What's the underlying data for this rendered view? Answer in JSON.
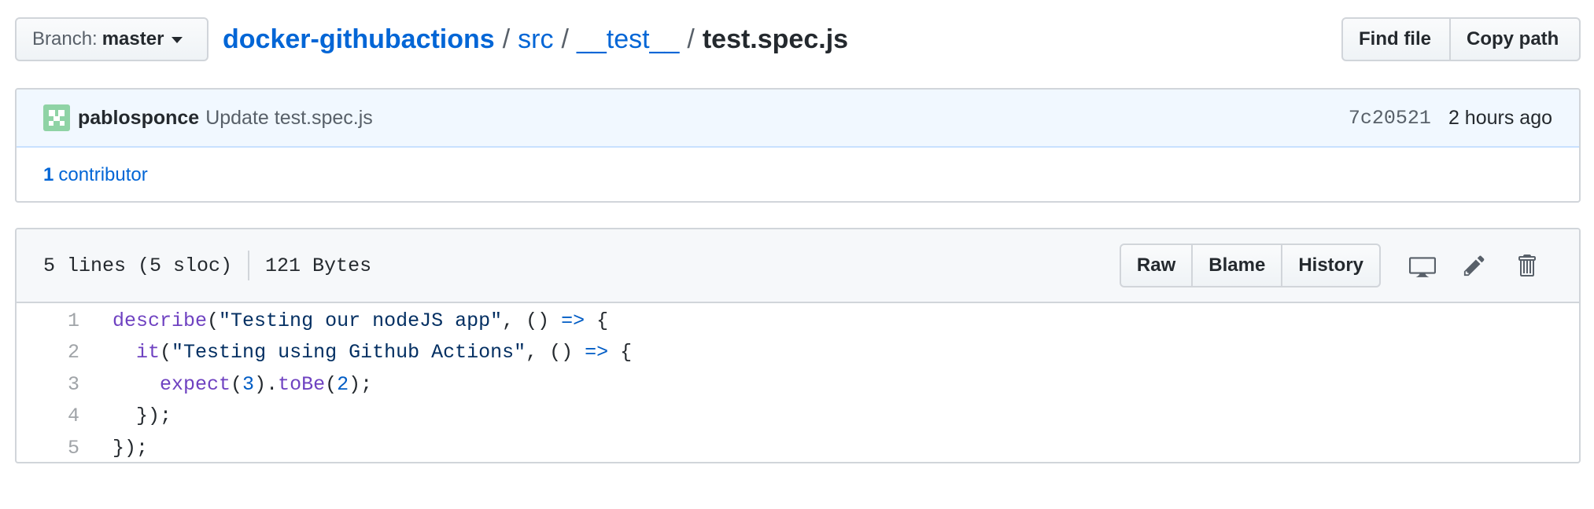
{
  "branch": {
    "label": "Branch:",
    "name": "master"
  },
  "breadcrumb": {
    "repo": "docker-githubactions",
    "segments": [
      "src",
      "__test__"
    ],
    "file": "test.spec.js",
    "separator": "/"
  },
  "file_nav": {
    "find_file": "Find file",
    "copy_path": "Copy path"
  },
  "commit": {
    "author": "pablosponce",
    "message": "Update test.spec.js",
    "sha": "7c20521",
    "time": "2 hours ago"
  },
  "contributors": {
    "count": "1",
    "label": "contributor"
  },
  "file_info": {
    "lines": "5 lines (5 sloc)",
    "size": "121 Bytes"
  },
  "file_actions": {
    "raw": "Raw",
    "blame": "Blame",
    "history": "History"
  },
  "icons": {
    "desktop": "desktop-icon",
    "edit": "pencil-icon",
    "delete": "trash-icon",
    "caret": "caret-down-icon"
  },
  "colors": {
    "link": "#0366d6",
    "commit_bg": "#f1f8ff",
    "fn": "#6f42c1",
    "keyword": "#005cc5",
    "string": "#032f62"
  },
  "code": {
    "line_numbers": [
      "1",
      "2",
      "3",
      "4",
      "5"
    ],
    "l1": {
      "fn": "describe",
      "open": "(",
      "str": "\"Testing our nodeJS app\"",
      "mid": ", () ",
      "arrow": "=>",
      "end": " {"
    },
    "l2": {
      "indent": "  ",
      "fn": "it",
      "open": "(",
      "str": "\"Testing using Github Actions\"",
      "mid": ", () ",
      "arrow": "=>",
      "end": " {"
    },
    "l3": {
      "indent": "    ",
      "fn": "expect",
      "open": "(",
      "num1": "3",
      "close": ").",
      "fn2": "toBe",
      "open2": "(",
      "num2": "2",
      "end": ");"
    },
    "l4": {
      "text": "  });"
    },
    "l5": {
      "text": "});"
    }
  }
}
